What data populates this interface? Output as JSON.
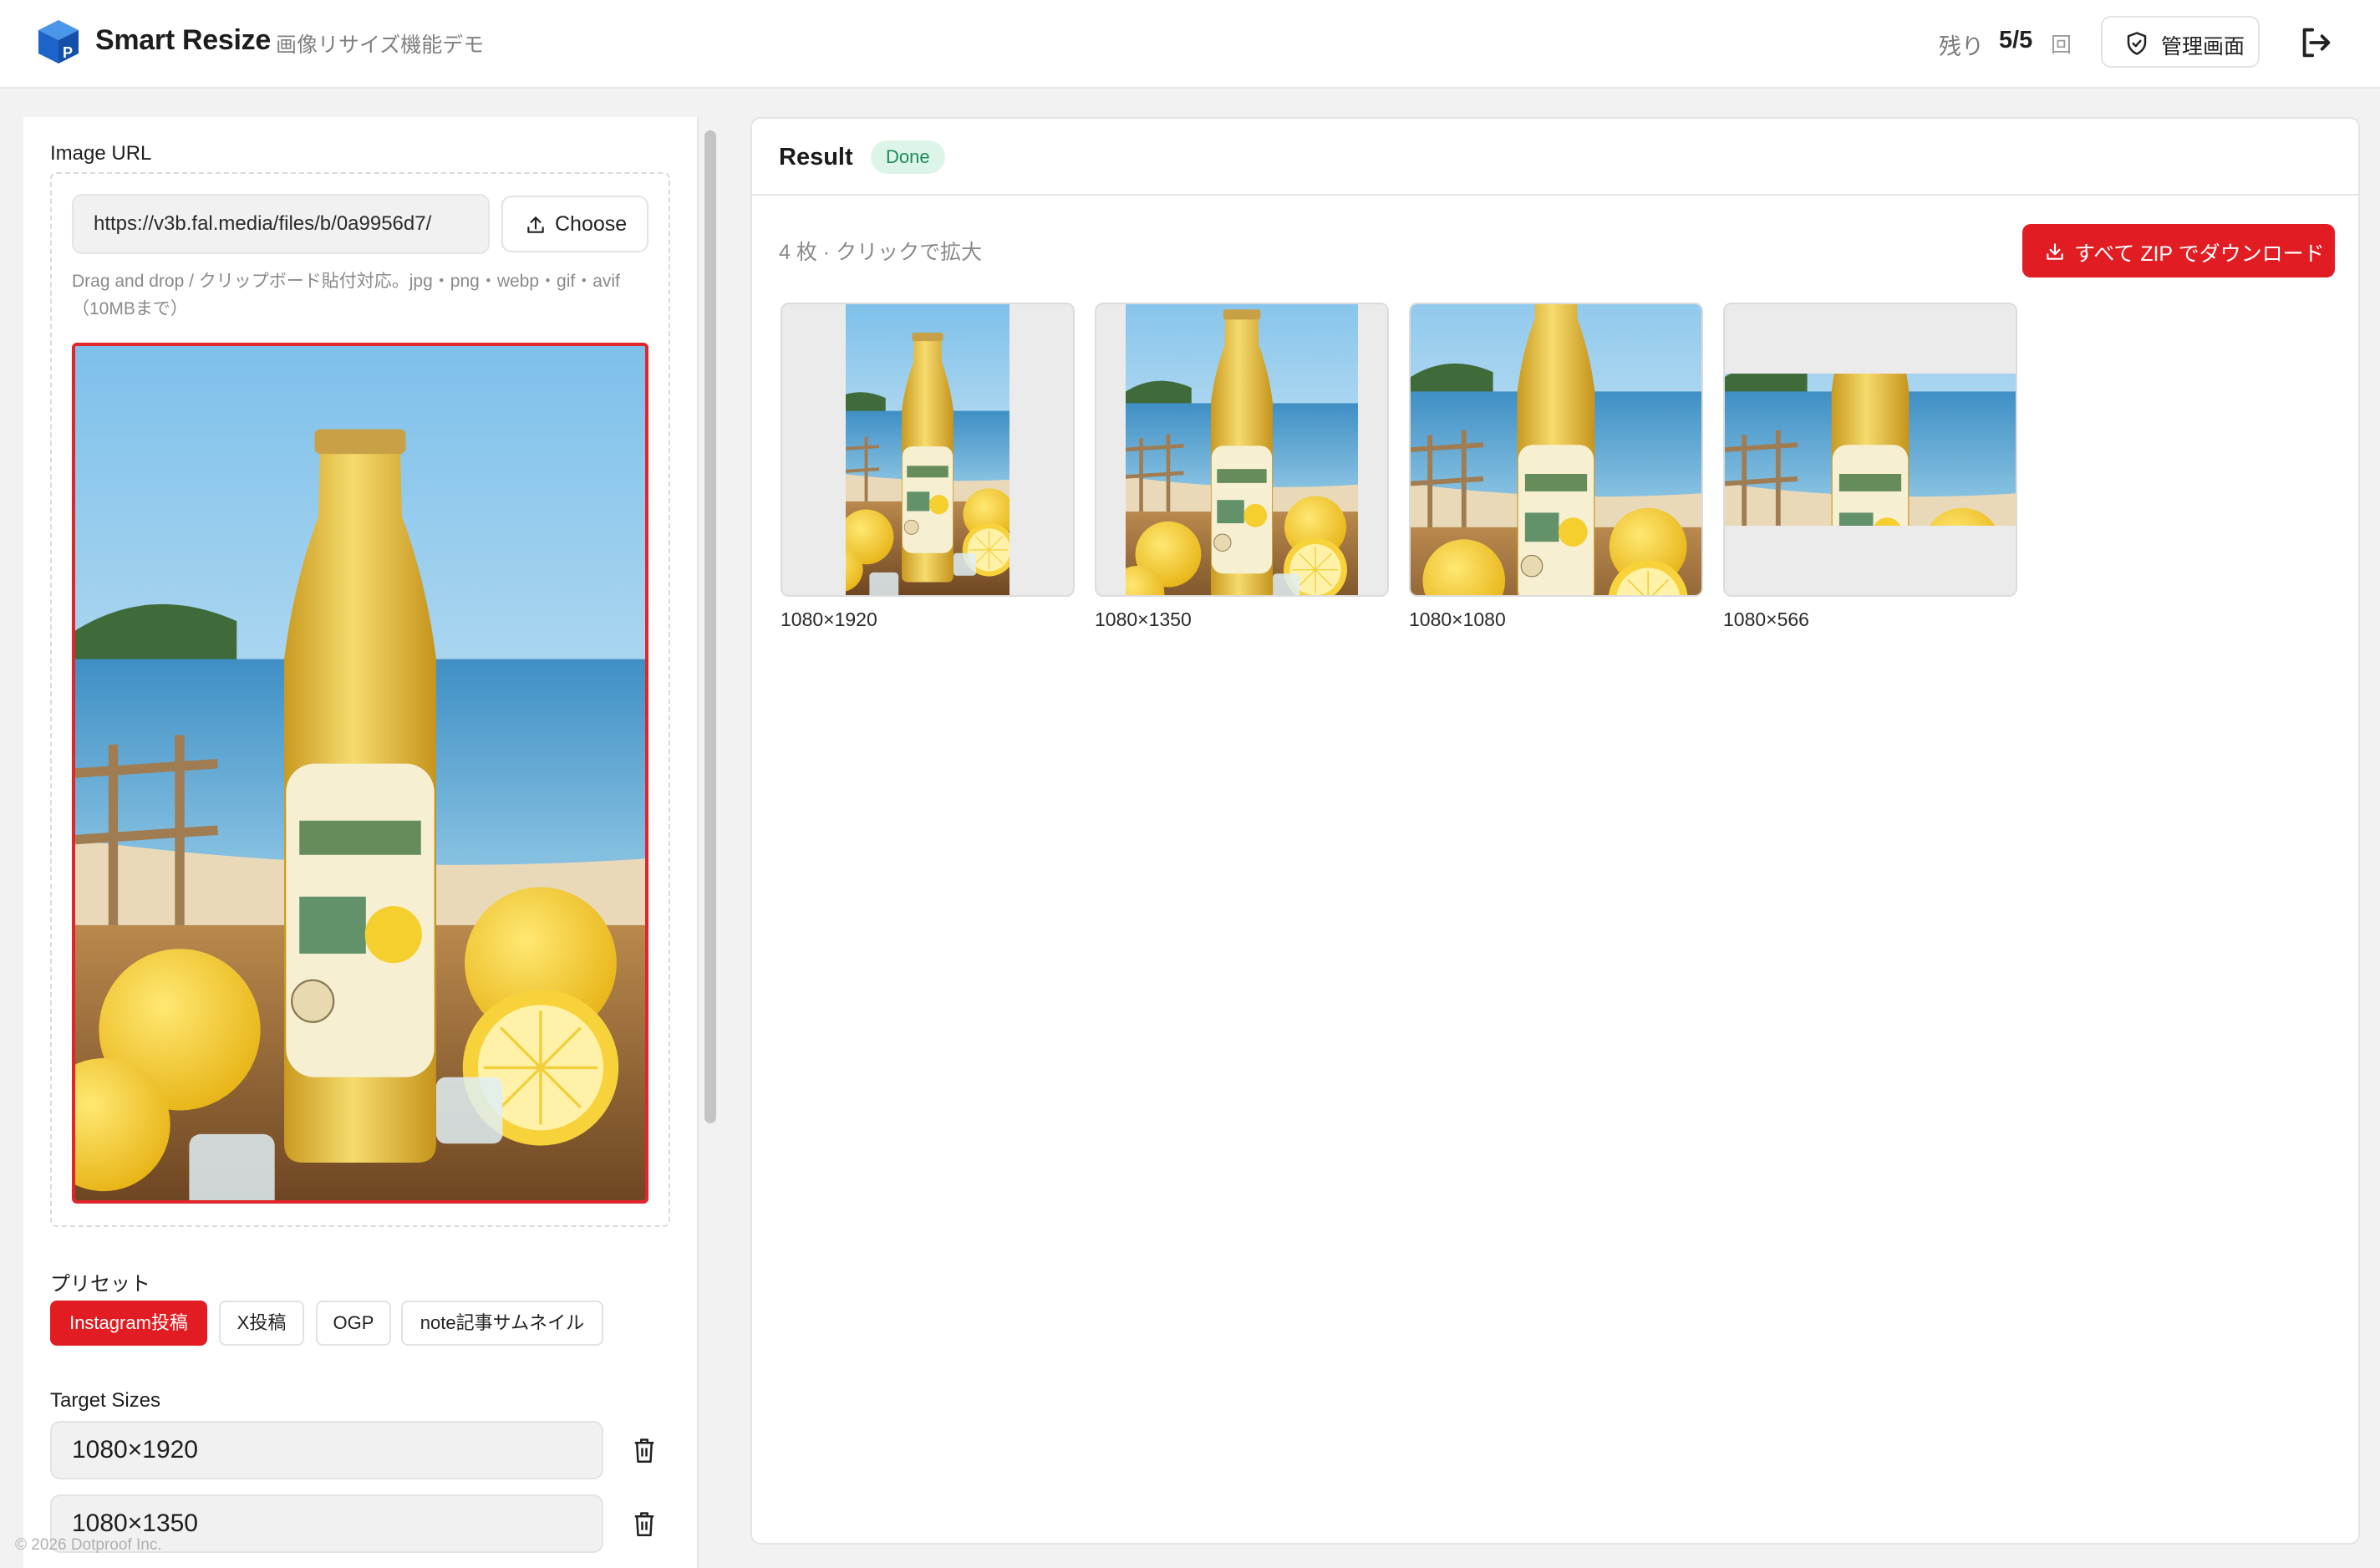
{
  "header": {
    "brand": "Smart Resize",
    "subtitle": "画像リサイズ機能デモ",
    "remaining_label": "残り",
    "remaining_count": "5/5",
    "remaining_unit": "回",
    "admin_label": "管理画面"
  },
  "sidebar": {
    "image_url_label": "Image URL",
    "url_value": "https://v3b.fal.media/files/b/0a9956d7/",
    "choose_label": "Choose",
    "hint": "Drag and drop / クリップボード貼付対応。jpg・png・webp・gif・avif（10MBまで）",
    "preset_label": "プリセット",
    "presets": [
      {
        "label": "Instagram投稿",
        "active": true
      },
      {
        "label": "X投稿",
        "active": false
      },
      {
        "label": "OGP",
        "active": false
      },
      {
        "label": "note記事サムネイル",
        "active": false
      }
    ],
    "target_sizes_label": "Target Sizes",
    "target_sizes": [
      "1080×1920",
      "1080×1350"
    ],
    "copyright": "© 2026 Dotproof Inc."
  },
  "result": {
    "title": "Result",
    "status": "Done",
    "count_text": "4 枚 · クリックで拡大",
    "zip_label": "すべて ZIP でダウンロード",
    "thumbnails": [
      {
        "label": "1080×1920"
      },
      {
        "label": "1080×1350"
      },
      {
        "label": "1080×1080"
      },
      {
        "label": "1080×566"
      }
    ]
  },
  "colors": {
    "accent": "#e11d23",
    "status_bg": "#dcf5e8",
    "status_text": "#1f8a55",
    "logo": "#1f6fd1"
  },
  "icons": {
    "logo": "cube-logo-icon",
    "admin": "shield-check-icon",
    "logout": "logout-icon",
    "choose": "upload-icon",
    "zip": "download-icon",
    "delete": "trash-icon"
  }
}
